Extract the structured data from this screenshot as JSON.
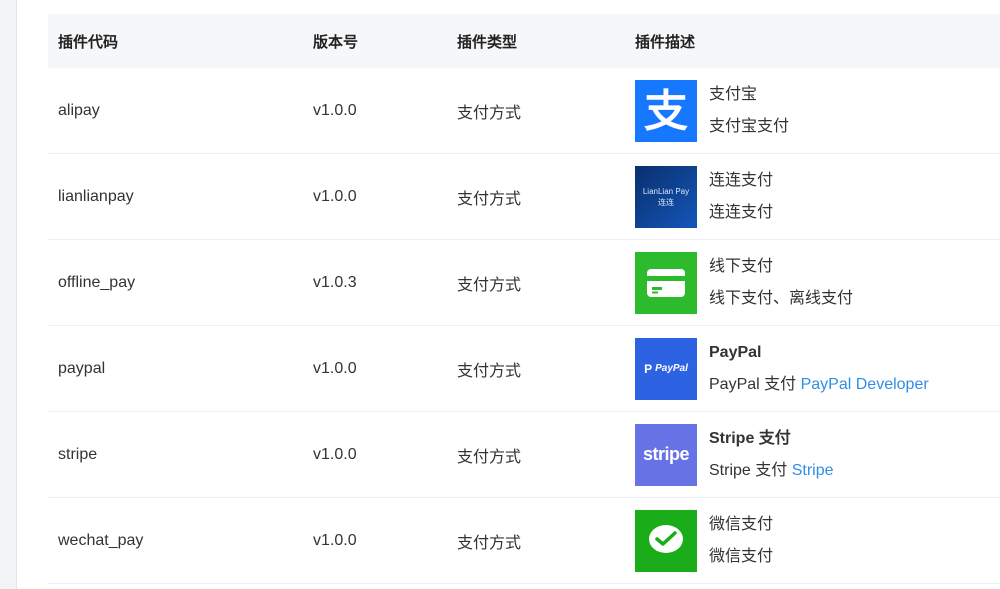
{
  "table": {
    "headers": {
      "code": "插件代码",
      "version": "版本号",
      "type": "插件类型",
      "description": "插件描述"
    },
    "rows": [
      {
        "code": "alipay",
        "version": "v1.0.0",
        "type": "支付方式",
        "logo": {
          "icon": "alipay-logo",
          "bg": "#1677ff",
          "text": "支"
        },
        "title": "支付宝",
        "title_bold": false,
        "desc": "支付宝支付",
        "link": ""
      },
      {
        "code": "lianlianpay",
        "version": "v1.0.0",
        "type": "支付方式",
        "logo": {
          "icon": "lianlianpay-logo",
          "bg": "#0c3b87",
          "text_line1": "LianLian Pay",
          "text_line2": "连连"
        },
        "title": "连连支付",
        "title_bold": false,
        "desc": "连连支付",
        "link": ""
      },
      {
        "code": "offline_pay",
        "version": "v1.0.3",
        "type": "支付方式",
        "logo": {
          "icon": "card-logo",
          "bg": "#2dbb2e"
        },
        "title": "线下支付",
        "title_bold": false,
        "desc": "线下支付、离线支付",
        "link": ""
      },
      {
        "code": "paypal",
        "version": "v1.0.0",
        "type": "支付方式",
        "logo": {
          "icon": "paypal-logo",
          "bg": "#2d63e2",
          "text": "PayPal"
        },
        "title": "PayPal",
        "title_bold": true,
        "desc": "PayPal 支付",
        "link": "PayPal Developer"
      },
      {
        "code": "stripe",
        "version": "v1.0.0",
        "type": "支付方式",
        "logo": {
          "icon": "stripe-logo",
          "bg": "#6772e5",
          "text": "stripe"
        },
        "title": "Stripe 支付",
        "title_bold": true,
        "desc": "Stripe 支付",
        "link": "Stripe"
      },
      {
        "code": "wechat_pay",
        "version": "v1.0.0",
        "type": "支付方式",
        "logo": {
          "icon": "wechat-logo",
          "bg": "#1aad19"
        },
        "title": "微信支付",
        "title_bold": false,
        "desc": "微信支付",
        "link": ""
      }
    ]
  },
  "colors": {
    "link": "#2f8fe6",
    "header_bg": "#f6f7f9",
    "row_border": "#eceef1"
  }
}
